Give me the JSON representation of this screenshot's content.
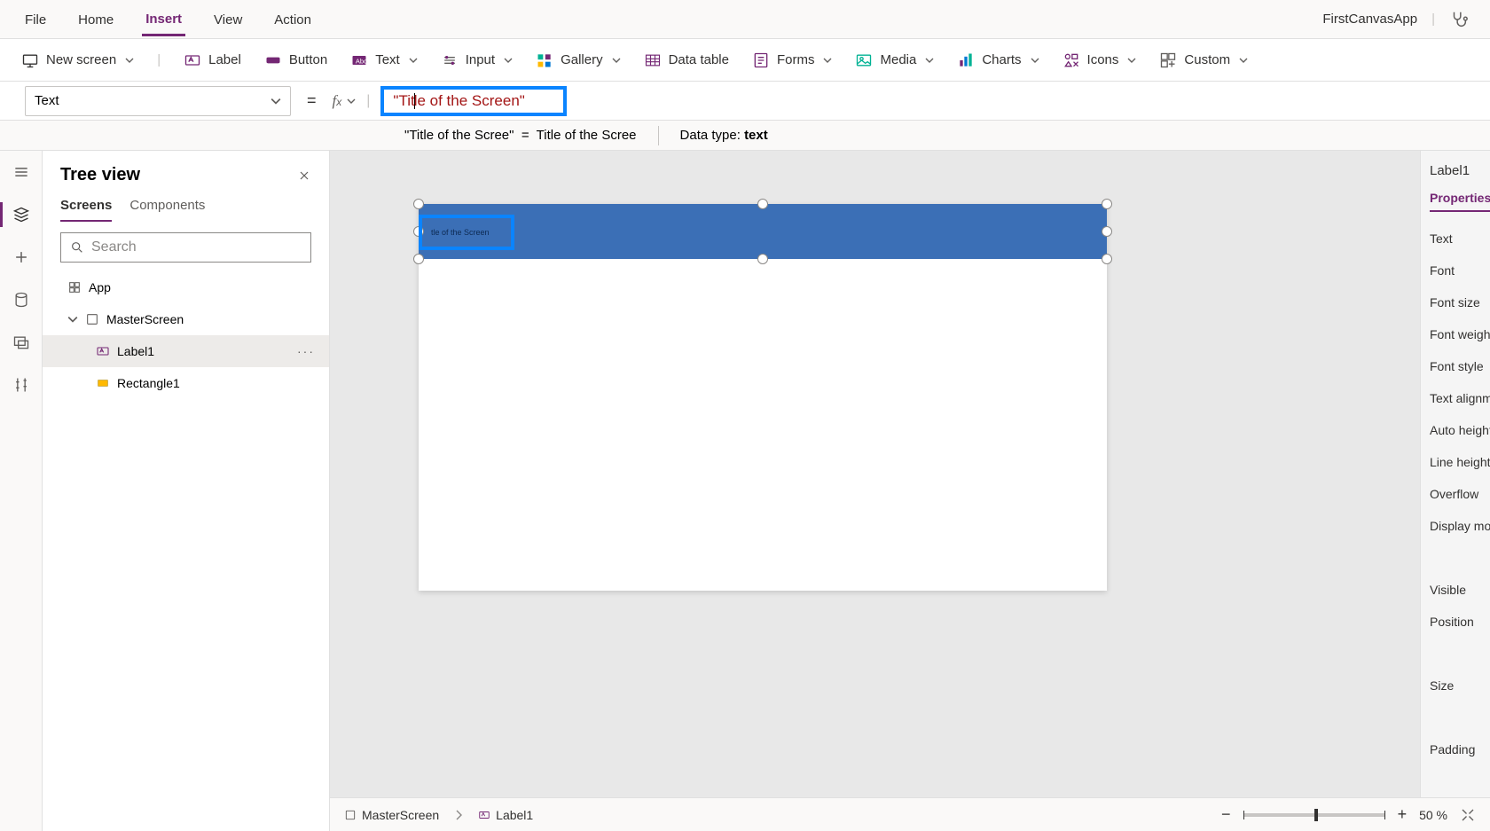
{
  "menubar": {
    "items": [
      "File",
      "Home",
      "Insert",
      "View",
      "Action"
    ],
    "active_index": 2,
    "app_name": "FirstCanvasApp"
  },
  "ribbon": {
    "new_screen": "New screen",
    "label": "Label",
    "button": "Button",
    "text": "Text",
    "input": "Input",
    "gallery": "Gallery",
    "data_table": "Data table",
    "forms": "Forms",
    "media": "Media",
    "charts": "Charts",
    "icons": "Icons",
    "custom": "Custom"
  },
  "formula": {
    "property": "Text",
    "value": "\"Title of the Screen\"",
    "preview_lhs": "\"Title of the Scree\"",
    "preview_eq": "=",
    "preview_rhs": "Title of the Scree",
    "data_type_label": "Data type: ",
    "data_type_value": "text"
  },
  "tree": {
    "title": "Tree view",
    "tabs": [
      "Screens",
      "Components"
    ],
    "active_tab": 0,
    "search_placeholder": "Search",
    "app_node": "App",
    "screen_node": "MasterScreen",
    "items": [
      {
        "name": "Label1",
        "selected": true
      },
      {
        "name": "Rectangle1",
        "selected": false
      }
    ]
  },
  "canvas": {
    "label_text": "tle of the Screen"
  },
  "properties": {
    "object": "Label1",
    "tab": "Properties",
    "rows": [
      "Text",
      "Font",
      "Font size",
      "Font weight",
      "Font style",
      "Text alignm",
      "Auto height",
      "Line height",
      "Overflow",
      "Display mo",
      "",
      "Visible",
      "Position",
      "",
      "Size",
      "",
      "Padding"
    ]
  },
  "statusbar": {
    "crumbs": [
      "MasterScreen",
      "Label1"
    ],
    "zoom_value": "50",
    "zoom_unit": "%"
  }
}
